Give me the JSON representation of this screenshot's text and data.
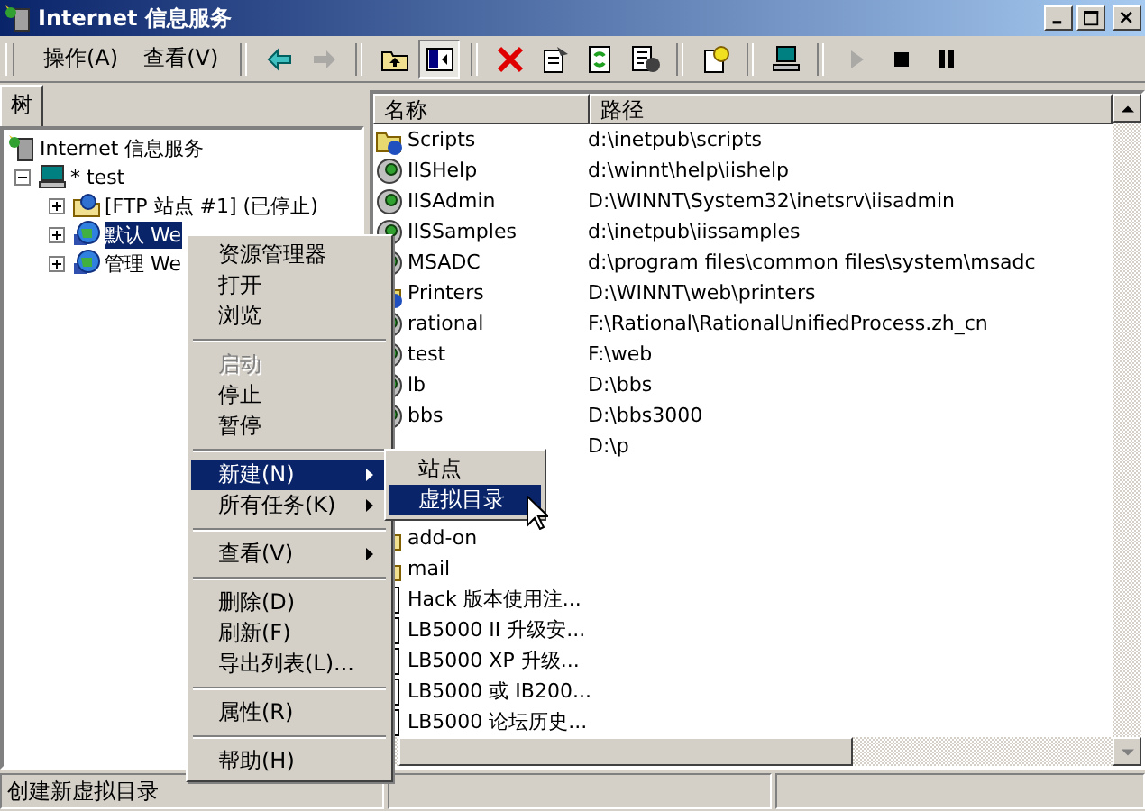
{
  "window": {
    "title": "Internet 信息服务"
  },
  "menu": [
    {
      "label": "操作(A)"
    },
    {
      "label": "查看(V)"
    }
  ],
  "toolbar": [
    {
      "kind": "sep"
    },
    {
      "kind": "back",
      "disabled": false,
      "pressed": false
    },
    {
      "kind": "forward",
      "disabled": true,
      "pressed": false
    },
    {
      "kind": "sep"
    },
    {
      "kind": "up",
      "disabled": false,
      "pressed": false
    },
    {
      "kind": "tree",
      "disabled": false,
      "pressed": true
    },
    {
      "kind": "sep"
    },
    {
      "kind": "delete",
      "disabled": false,
      "pressed": false
    },
    {
      "kind": "properties",
      "disabled": false,
      "pressed": false
    },
    {
      "kind": "refresh",
      "disabled": false,
      "pressed": false
    },
    {
      "kind": "export",
      "disabled": false,
      "pressed": false
    },
    {
      "kind": "sep"
    },
    {
      "kind": "help",
      "disabled": false,
      "pressed": false
    },
    {
      "kind": "sep"
    },
    {
      "kind": "computer",
      "disabled": false,
      "pressed": false
    },
    {
      "kind": "sep"
    },
    {
      "kind": "play",
      "disabled": true,
      "pressed": false
    },
    {
      "kind": "stop",
      "disabled": false,
      "pressed": false
    },
    {
      "kind": "pause",
      "disabled": false,
      "pressed": false
    }
  ],
  "tree_tab": {
    "label": "树"
  },
  "tree": [
    {
      "label": "Internet 信息服务",
      "kind": "iis",
      "selected": false,
      "children": [
        {
          "label": "* test",
          "kind": "computer",
          "expanded": true,
          "selected": false,
          "children": [
            {
              "label": "[FTP 站点 #1] (已停止)",
              "kind": "ftp",
              "expanded": false,
              "selected": false
            },
            {
              "label": "默认 We",
              "kind": "web",
              "expanded": false,
              "selected": true
            },
            {
              "label": "管理 We",
              "kind": "web",
              "expanded": false,
              "selected": false
            }
          ]
        }
      ]
    }
  ],
  "list": {
    "columns": [
      "名称",
      "路径"
    ],
    "rows": [
      {
        "name": "Scripts",
        "path": "d:\\inetpub\\scripts",
        "kind": "vdir"
      },
      {
        "name": "IISHelp",
        "path": "d:\\winnt\\help\\iishelp",
        "kind": "app"
      },
      {
        "name": "IISAdmin",
        "path": "D:\\WINNT\\System32\\inetsrv\\iisadmin",
        "kind": "app"
      },
      {
        "name": "IISSamples",
        "path": "d:\\inetpub\\iissamples",
        "kind": "app"
      },
      {
        "name": "MSADC",
        "path": "d:\\program files\\common files\\system\\msadc",
        "kind": "app"
      },
      {
        "name": "Printers",
        "path": "D:\\WINNT\\web\\printers",
        "kind": "vdir"
      },
      {
        "name": "rational",
        "path": "F:\\Rational\\RationalUnifiedProcess.zh_cn",
        "kind": "app"
      },
      {
        "name": "test",
        "path": "F:\\web",
        "kind": "app"
      },
      {
        "name": "lb",
        "path": "D:\\bbs",
        "kind": "app"
      },
      {
        "name": "bbs",
        "path": "D:\\bbs3000",
        "kind": "app"
      },
      {
        "path": "D:\\p"
      },
      {},
      {},
      {
        "name": "add-on",
        "kind": "folder"
      },
      {
        "name": "mail",
        "kind": "folder"
      },
      {
        "name": "Hack 版本使用注...",
        "kind": "file"
      },
      {
        "name": "LB5000 II 升级安...",
        "kind": "file"
      },
      {
        "name": "LB5000 XP 升级...",
        "kind": "file"
      },
      {
        "name": "LB5000 或 IB200...",
        "kind": "file"
      },
      {
        "name": "LB5000 论坛历史...",
        "kind": "file"
      }
    ]
  },
  "context_menu": [
    {
      "kind": "item",
      "label": "资源管理器",
      "disabled": false,
      "selected": false
    },
    {
      "kind": "item",
      "label": "打开",
      "disabled": false,
      "selected": false
    },
    {
      "kind": "item",
      "label": "浏览",
      "disabled": false,
      "selected": false
    },
    {
      "kind": "sep"
    },
    {
      "kind": "item",
      "label": "启动",
      "disabled": true,
      "selected": false
    },
    {
      "kind": "item",
      "label": "停止",
      "disabled": false,
      "selected": false
    },
    {
      "kind": "item",
      "label": "暂停",
      "disabled": false,
      "selected": false
    },
    {
      "kind": "sep"
    },
    {
      "kind": "submenu",
      "label": "新建(N)",
      "disabled": false,
      "selected": true
    },
    {
      "kind": "submenu",
      "label": "所有任务(K)",
      "disabled": false,
      "selected": false
    },
    {
      "kind": "sep"
    },
    {
      "kind": "submenu",
      "label": "查看(V)",
      "disabled": false,
      "selected": false
    },
    {
      "kind": "sep"
    },
    {
      "kind": "item",
      "label": "删除(D)",
      "disabled": false,
      "selected": false
    },
    {
      "kind": "item",
      "label": "刷新(F)",
      "disabled": false,
      "selected": false
    },
    {
      "kind": "item",
      "label": "导出列表(L)...",
      "disabled": false,
      "selected": false
    },
    {
      "kind": "sep"
    },
    {
      "kind": "item",
      "label": "属性(R)",
      "disabled": false,
      "selected": false
    },
    {
      "kind": "sep"
    },
    {
      "kind": "item",
      "label": "帮助(H)",
      "disabled": false,
      "selected": false
    }
  ],
  "submenu": [
    {
      "label": "站点",
      "selected": false
    },
    {
      "label": "虚拟目录",
      "selected": true
    }
  ],
  "status_bar": {
    "text": "创建新虚拟目录"
  }
}
